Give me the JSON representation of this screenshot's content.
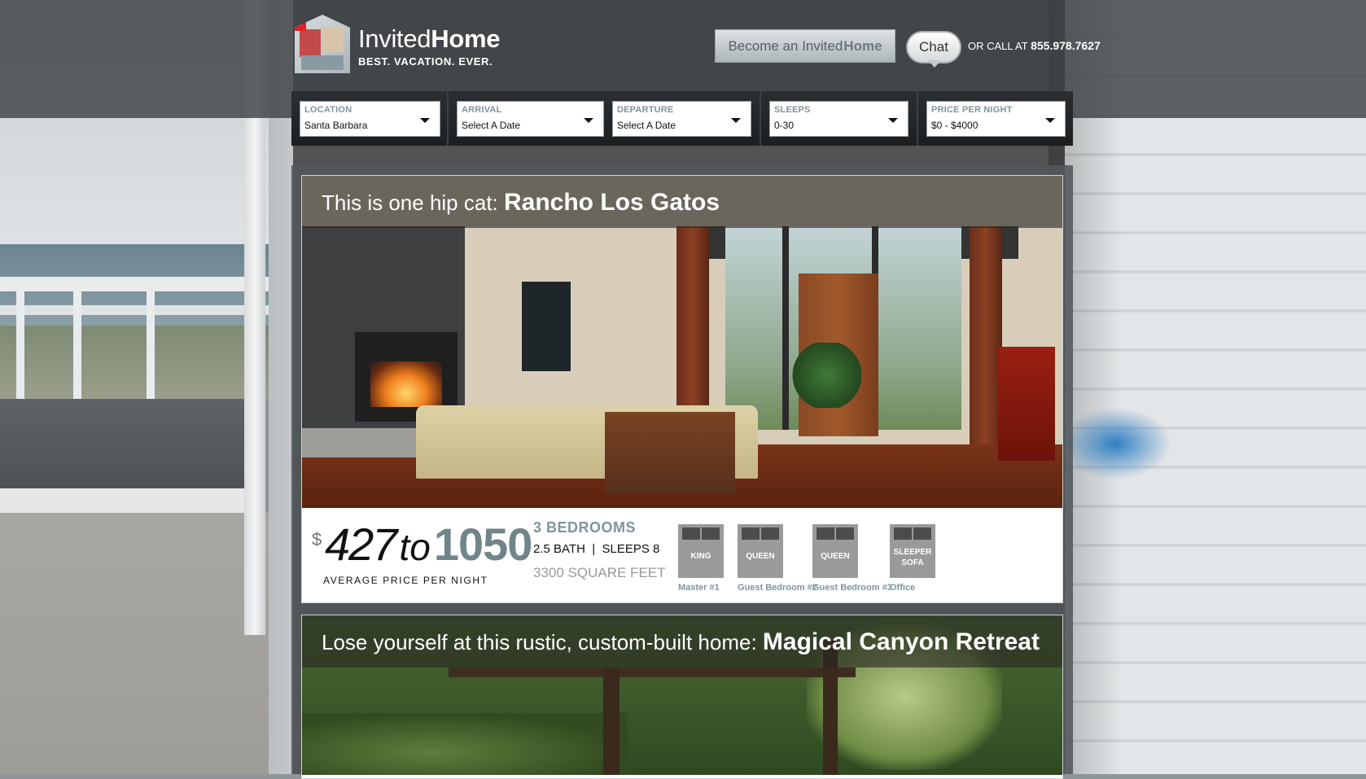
{
  "brand": {
    "name_light": "Invited",
    "name_bold": "Home",
    "tagline": "BEST. VACATION. EVER."
  },
  "header": {
    "become_label_prefix": "Become an ",
    "become_label_light": "Invited",
    "become_label_bold": "Home",
    "chat_label": "Chat",
    "call_prefix": "OR CALL AT",
    "phone": "855.978.7627"
  },
  "search": {
    "location": {
      "label": "LOCATION",
      "value": "Santa Barbara"
    },
    "arrival": {
      "label": "ARRIVAL",
      "value": "Select A Date"
    },
    "departure": {
      "label": "DEPARTURE",
      "value": "Select A Date"
    },
    "sleeps": {
      "label": "SLEEPS",
      "value": "0-30"
    },
    "price": {
      "label": "PRICE PER NIGHT",
      "value": "$0 - $4000"
    }
  },
  "listings": [
    {
      "tagline": "This is one hip cat: ",
      "name": "Rancho Los Gatos",
      "currency": "$",
      "price_low": "427",
      "price_to": "to",
      "price_high": "1050",
      "price_note": "AVERAGE PRICE PER NIGHT",
      "bedrooms": "3 BEDROOMS",
      "bath_sleeps": "2.5 BATH  |  SLEEPS 8",
      "sqft": "3300 SQUARE FEET",
      "beds": [
        {
          "type": "KING",
          "room": "Master #1"
        },
        {
          "type": "QUEEN",
          "room": "Guest Bedroom #2"
        },
        {
          "type": "QUEEN",
          "room": "Guest Bedroom #3"
        },
        {
          "type_line1": "SLEEPER",
          "type_line2": "SOFA",
          "room": "Office"
        }
      ]
    },
    {
      "tagline": "Lose yourself at this rustic, custom-built home: ",
      "name": "Magical Canyon Retreat"
    }
  ]
}
